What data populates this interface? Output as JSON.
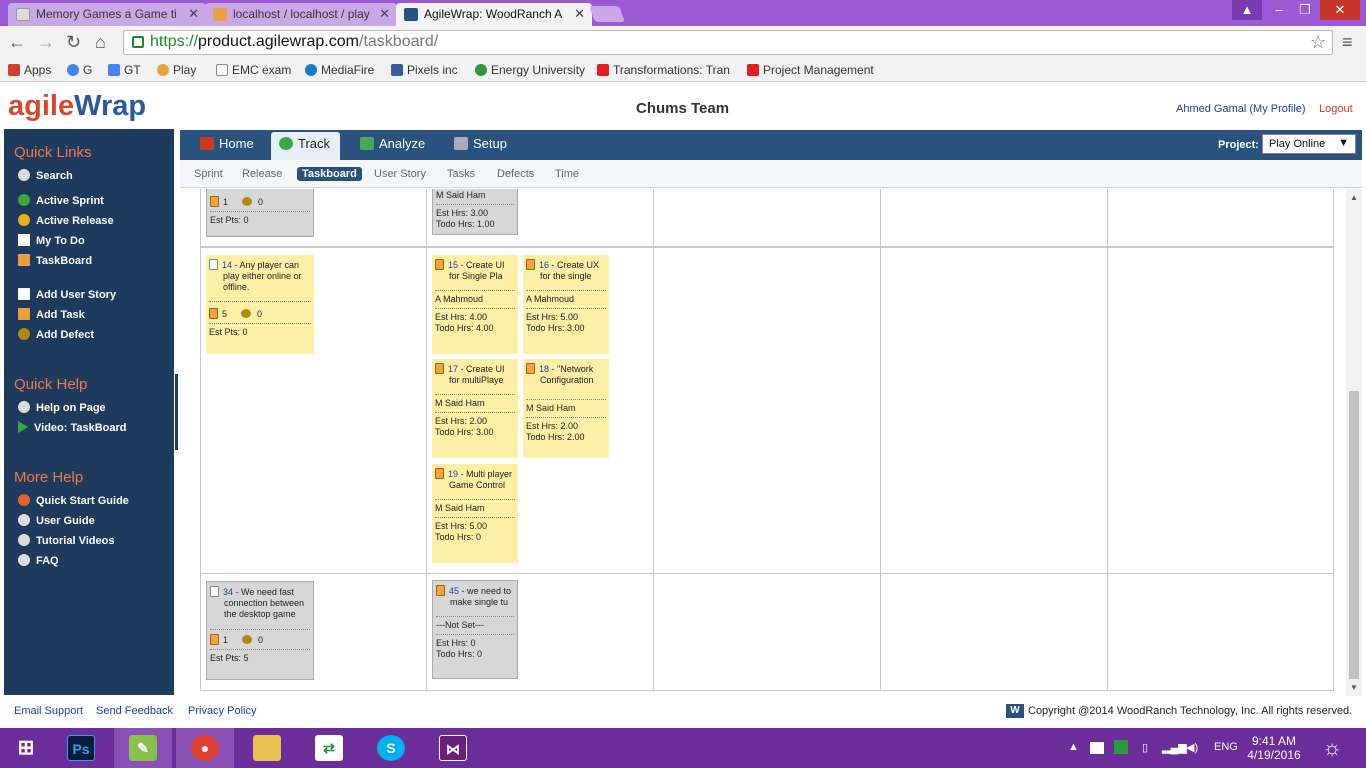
{
  "browser": {
    "tabs": [
      {
        "title": "Memory Games a Game ti",
        "icon": "page-icon"
      },
      {
        "title": "localhost / localhost / play",
        "icon": "phpmyadmin-icon"
      },
      {
        "title": "AgileWrap: WoodRanch A",
        "icon": "agilewrap-icon"
      }
    ],
    "url": {
      "proto": "https://",
      "host": "product.agilewrap.com",
      "path": "/taskboard/"
    },
    "bookmarks": [
      "Apps",
      "G",
      "GT",
      "Play",
      "EMC exam",
      "MediaFire",
      "Pixels inc",
      "Energy University",
      "Transformations: Tran",
      "Project Management"
    ]
  },
  "header": {
    "logo_a": "agile",
    "logo_b": "Wrap",
    "team": "Chums Team",
    "profile": "Ahmed Gamal (My Profile)",
    "logout": "Logout"
  },
  "sidebar": {
    "quick_links_title": "Quick Links",
    "quick_links": [
      "Search",
      "Active Sprint",
      "Active Release",
      "My To Do",
      "TaskBoard",
      "Add User Story",
      "Add Task",
      "Add Defect"
    ],
    "quick_help_title": "Quick Help",
    "quick_help": [
      "Help on Page",
      "Video: TaskBoard"
    ],
    "more_help_title": "More Help",
    "more_help": [
      "Quick Start Guide",
      "User Guide",
      "Tutorial Videos",
      "FAQ"
    ]
  },
  "nav": {
    "tabs": [
      "Home",
      "Track",
      "Analyze",
      "Setup"
    ],
    "active_tab": "Track",
    "subtabs": [
      "Sprint",
      "Release",
      "Taskboard",
      "User Story",
      "Tasks",
      "Defects",
      "Time"
    ],
    "active_subtab": "Taskboard",
    "project_label": "Project:",
    "project_value": "Play Online"
  },
  "board": {
    "row1_story": {
      "tasks": "1",
      "defects": "0",
      "est_pts": "Est Pts: 0"
    },
    "row1_task": {
      "owner": "M Said Ham",
      "est": "Est Hrs: 3.00",
      "todo": "Todo Hrs: 1.00"
    },
    "story14": {
      "id": "14",
      "title": " - Any player can play either online or offline.",
      "tasks": "5",
      "defects": "0",
      "est_pts": "Est Pts: 0"
    },
    "task15": {
      "id": "15",
      "title": " - Create UI for Single Pla",
      "owner": "A Mahmoud",
      "est": "Est Hrs: 4.00",
      "todo": "Todo Hrs: 4.00"
    },
    "task16": {
      "id": "16",
      "title": " - Create UX for the single",
      "owner": "A Mahmoud",
      "est": "Est Hrs: 5.00",
      "todo": "Todo Hrs: 3.00"
    },
    "task17": {
      "id": "17",
      "title": " - Create UI for multiPlaye",
      "owner": "M Said Ham",
      "est": "Est Hrs: 2.00",
      "todo": "Todo Hrs: 3.00"
    },
    "task18": {
      "id": "18",
      "title": " - \"Network Configuration",
      "owner": "M Said Ham",
      "est": "Est Hrs: 2.00",
      "todo": "Todo Hrs: 2.00"
    },
    "task19": {
      "id": "19",
      "title": " - Multi player Game Control",
      "owner": "M Said Ham",
      "est": "Est Hrs: 5.00",
      "todo": "Todo Hrs: 0"
    },
    "story34": {
      "id": "34",
      "title": " - We need fast connection between the desktop game",
      "tasks": "1",
      "defects": "0",
      "est_pts": "Est Pts: 5"
    },
    "task45": {
      "id": "45",
      "title": " - we need to make single tu",
      "owner": "---Not Set---",
      "est": "Est Hrs: 0",
      "todo": "Todo Hrs: 0"
    }
  },
  "footer": {
    "links": [
      "Email Support",
      "Send Feedback",
      "Privacy Policy"
    ],
    "copyright": "Copyright @2014 WoodRanch Technology, Inc. All rights reserved."
  },
  "taskbar": {
    "lang": "ENG",
    "time": "9:41 AM",
    "date": "4/19/2016"
  },
  "colors": {
    "accent": "#2a527f",
    "sidebar": "#1e3a5c",
    "card_yellow": "#fdf0a6",
    "card_gray": "#d7d7d7",
    "taskbar": "#6a2d9a"
  }
}
